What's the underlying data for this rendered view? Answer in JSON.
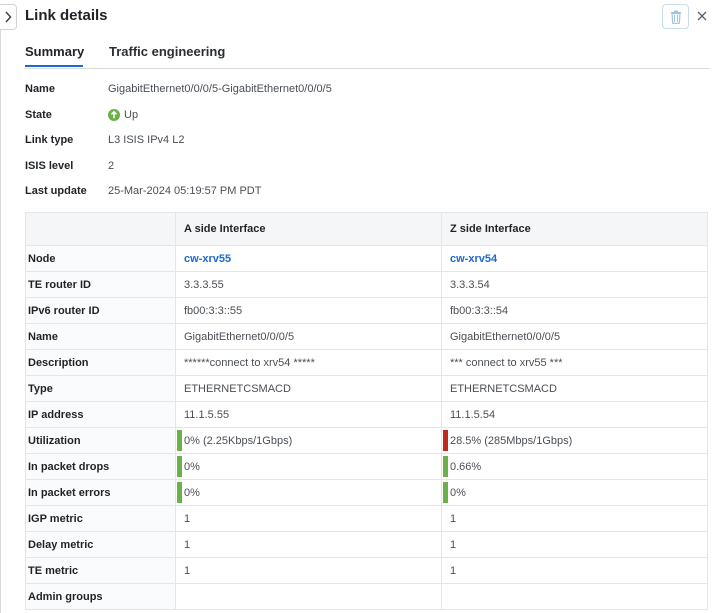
{
  "title": "Link details",
  "icons": {
    "collapse": "chevron-right-icon",
    "delete": "trash-icon",
    "close": "close-icon",
    "state": "arrow-up-circle-icon"
  },
  "colors": {
    "accent": "#1d69cc",
    "ok": "#6cb04a",
    "critical": "#c0291e"
  },
  "tabs": [
    {
      "label": "Summary",
      "active": true
    },
    {
      "label": "Traffic engineering",
      "active": false
    }
  ],
  "details": [
    {
      "label": "Name",
      "value": "GigabitEthernet0/0/0/5-GigabitEthernet0/0/0/5"
    },
    {
      "label": "State",
      "value": "Up"
    },
    {
      "label": "Link type",
      "value": "L3 ISIS IPv4 L2"
    },
    {
      "label": "ISIS level",
      "value": "2"
    },
    {
      "label": "Last update",
      "value": "25-Mar-2024 05:19:57 PM PDT"
    }
  ],
  "table": {
    "headers": [
      "",
      "A side Interface",
      "Z side Interface"
    ],
    "rows": [
      {
        "label": "Node",
        "a": "cw-xrv55",
        "z": "cw-xrv54"
      },
      {
        "label": "TE router ID",
        "a": "3.3.3.55",
        "z": "3.3.3.54"
      },
      {
        "label": "IPv6 router ID",
        "a": "fb00:3:3::55",
        "z": "fb00:3:3::54"
      },
      {
        "label": "Name",
        "a": "GigabitEthernet0/0/0/5",
        "z": "GigabitEthernet0/0/0/5"
      },
      {
        "label": "Description",
        "a": "******connect to xrv54 *****",
        "z": "*** connect to xrv55 ***"
      },
      {
        "label": "Type",
        "a": "ETHERNETCSMACD",
        "z": "ETHERNETCSMACD"
      },
      {
        "label": "IP address",
        "a": "11.1.5.55",
        "z": "11.1.5.54"
      },
      {
        "label": "Utilization",
        "a": "0% (2.25Kbps/1Gbps)",
        "z": "28.5% (285Mbps/1Gbps)"
      },
      {
        "label": "In packet drops",
        "a": "0%",
        "z": "0.66%"
      },
      {
        "label": "In packet errors",
        "a": "0%",
        "z": "0%"
      },
      {
        "label": "IGP metric",
        "a": "1",
        "z": "1"
      },
      {
        "label": "Delay metric",
        "a": "1",
        "z": "1"
      },
      {
        "label": "TE metric",
        "a": "1",
        "z": "1"
      },
      {
        "label": "Admin groups",
        "a": "",
        "z": ""
      }
    ]
  }
}
